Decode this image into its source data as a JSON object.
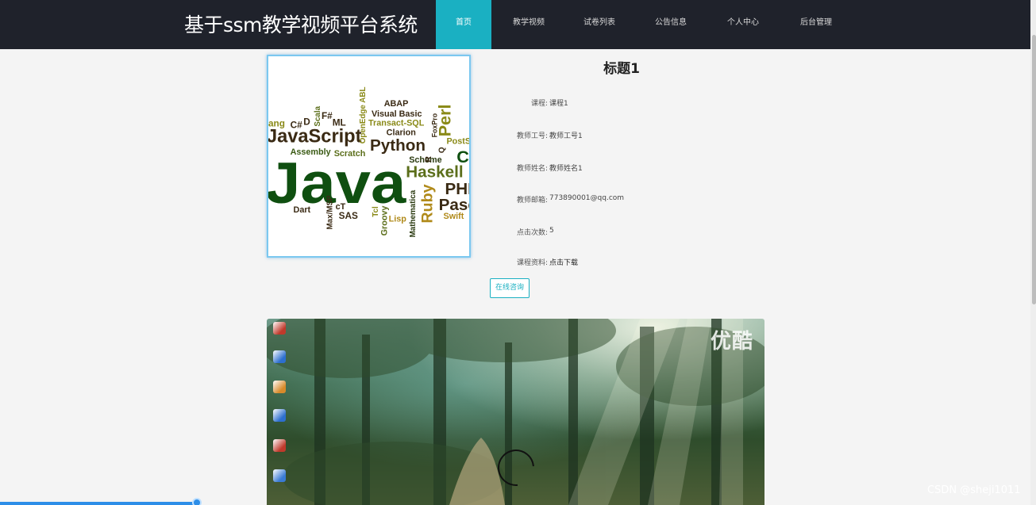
{
  "header": {
    "brand": "基于ssm教学视频平台系统",
    "nav": [
      {
        "label": "首页",
        "active": true
      },
      {
        "label": "教学视频",
        "active": false
      },
      {
        "label": "试卷列表",
        "active": false
      },
      {
        "label": "公告信息",
        "active": false
      },
      {
        "label": "个人中心",
        "active": false
      },
      {
        "label": "后台管理",
        "active": false
      }
    ]
  },
  "detail": {
    "title": "标题1",
    "rows": [
      {
        "label": "课程:",
        "value": "课程1"
      },
      {
        "label": "教师工号:",
        "value": "教师工号1"
      },
      {
        "label": "教师姓名:",
        "value": "教师姓名1"
      },
      {
        "label": "教师邮箱:",
        "value": "773890001@qq.com"
      },
      {
        "label": "点击次数:",
        "value": "5"
      },
      {
        "label": "课程资料:",
        "value": "点击下载"
      }
    ],
    "consult_button": "在线咨询"
  },
  "cover_words": [
    "Java",
    "JavaScript",
    "Python",
    "Haskell",
    "Ruby",
    "PHP",
    "Pascal",
    "Perl",
    "ABAP",
    "Visual Basic",
    "Transact-SQL",
    "Clarion",
    "Scheme",
    "Assembly",
    "Scratch",
    "OpenEdge ABL",
    "FoxPro",
    "Scala",
    "C#",
    "F#",
    "ML",
    "D",
    "Erlang",
    "Dart",
    "Max/MSP",
    "SAS",
    "cT",
    "Tcl",
    "Groovy",
    "Lisp",
    "Mathematica",
    "Swift",
    "PostScript",
    "R",
    "Q",
    "C"
  ],
  "video": {
    "watermark": "优酷",
    "progress": 0.19,
    "icon_colors": [
      "#c0392b",
      "#2d6fcf",
      "#d88a2a",
      "#2d6fcf",
      "#c0392b",
      "#3a7bd5"
    ]
  },
  "footer": {
    "credit": "CSDN @sheji1011"
  },
  "colors": {
    "accent": "#1ab0c2",
    "navbar": "#1f222b",
    "progress": "#2d8ee8"
  }
}
